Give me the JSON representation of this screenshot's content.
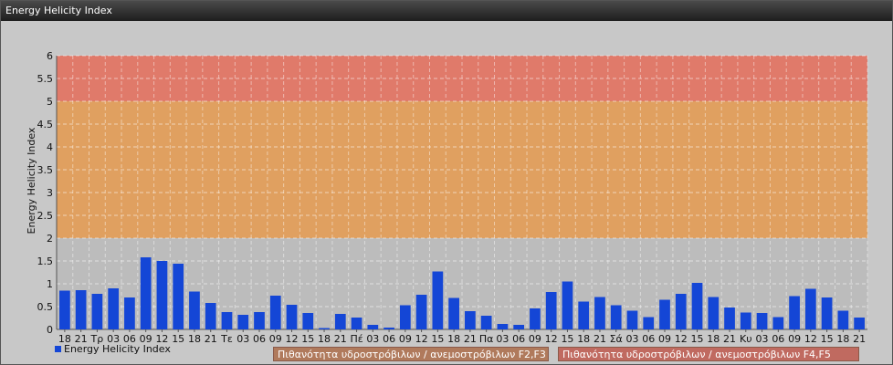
{
  "window": {
    "title": "Energy Helicity Index"
  },
  "chart_data": {
    "type": "bar",
    "title": "",
    "xlabel": "",
    "ylabel": "Energy Helicity Index",
    "ylim": [
      0,
      6
    ],
    "yticks": [
      "0",
      "0.5",
      "1",
      "1.5",
      "2",
      "2.5",
      "3",
      "3.5",
      "4",
      "4.5",
      "5",
      "5.5",
      "6"
    ],
    "categories": [
      "18",
      "21",
      "Τρ",
      "03",
      "06",
      "09",
      "12",
      "15",
      "18",
      "21",
      "Τε",
      "03",
      "06",
      "09",
      "12",
      "15",
      "18",
      "21",
      "Πέ",
      "03",
      "06",
      "09",
      "12",
      "15",
      "18",
      "21",
      "Πα",
      "03",
      "06",
      "09",
      "12",
      "15",
      "18",
      "21",
      "Σά",
      "03",
      "06",
      "09",
      "12",
      "15",
      "18",
      "21",
      "Κυ",
      "03",
      "06",
      "09",
      "12",
      "15",
      "18",
      "21"
    ],
    "series": [
      {
        "name": "Energy Helicity Index",
        "color": "#1446d6",
        "values": [
          0.85,
          0.86,
          0.78,
          0.9,
          0.7,
          1.58,
          1.5,
          1.44,
          0.83,
          0.58,
          0.38,
          0.32,
          0.38,
          0.74,
          0.54,
          0.36,
          0.03,
          0.34,
          0.26,
          0.1,
          0.04,
          0.53,
          0.76,
          1.27,
          0.69,
          0.4,
          0.3,
          0.12,
          0.1,
          0.46,
          0.82,
          1.05,
          0.61,
          0.71,
          0.53,
          0.41,
          0.27,
          0.65,
          0.78,
          1.02,
          0.71,
          0.48,
          0.37,
          0.36,
          0.27,
          0.73,
          0.89,
          0.7,
          0.41,
          0.26
        ]
      }
    ],
    "bands": [
      {
        "from": 2,
        "to": 5,
        "color": "#e0a060",
        "label": "Πιθανότητα υδροστρόβιλων / ανεμοστρόβιλων F2,F3"
      },
      {
        "from": 5,
        "to": 6,
        "color": "#e07a6a",
        "label": "Πιθανότητα υδροστρόβιλων / ανεμοστρόβιλων F4,F5"
      }
    ],
    "grid": true,
    "legend": "bottom-left"
  }
}
